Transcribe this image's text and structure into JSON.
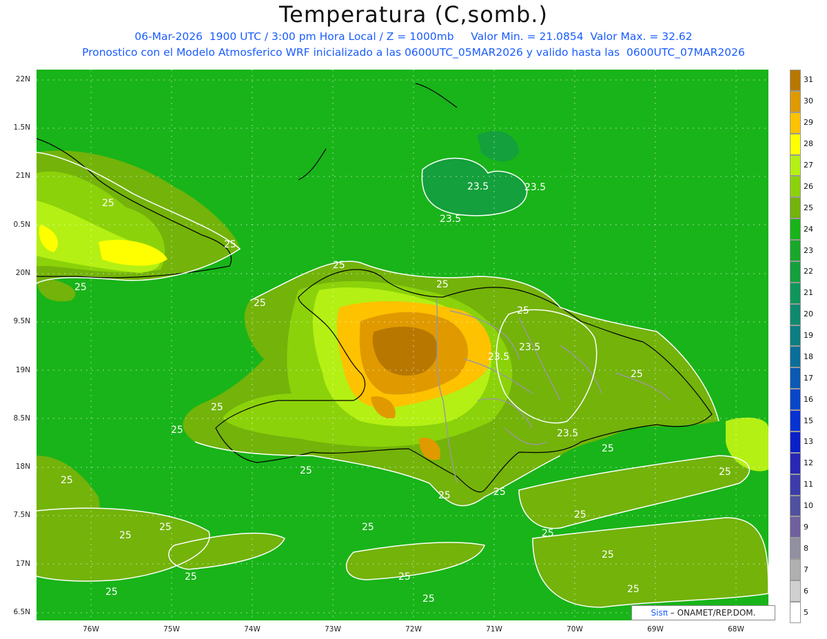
{
  "header": {
    "title": "Temperatura (C,somb.)",
    "line1": "06-Mar-2026  1900 UTC / 3:00 pm Hora Local / Z = 1000mb     Valor Min. = 21.0854  Valor Max. = 32.62",
    "line2": "Pronostico con el Modelo Atmosferico WRF inicializado a las 0600UTC_05MAR2026 y valido hasta las  0600UTC_07MAR2026"
  },
  "y_axis_labels": [
    "22N",
    "1.5N",
    "21N",
    "0.5N",
    "20N",
    "9.5N",
    "19N",
    "8.5N",
    "18N",
    "7.5N",
    "17N",
    "6.5N"
  ],
  "x_axis_labels": [
    "76W",
    "75W",
    "74W",
    "73W",
    "72W",
    "71W",
    "70W",
    "69W",
    "68W"
  ],
  "colorbar": {
    "levels": [
      "31",
      "30",
      "29",
      "28",
      "27",
      "26",
      "25",
      "24",
      "23",
      "22",
      "21",
      "20",
      "19",
      "18",
      "17",
      "16",
      "15",
      "13",
      "12",
      "11",
      "10",
      "9",
      "8",
      "7",
      "6",
      "5"
    ],
    "colors": [
      "#b87800",
      "#e09a00",
      "#ffc200",
      "#ffff00",
      "#b4f014",
      "#8cd20a",
      "#73b30a",
      "#19b419",
      "#19a82a",
      "#14a03c",
      "#10965a",
      "#0f8a6e",
      "#0c7e82",
      "#0a6e9a",
      "#0a5ab4",
      "#0846c8",
      "#0632d2",
      "#0a20c8",
      "#2828b4",
      "#3c3caa",
      "#5050a0",
      "#7060a0",
      "#9090a0",
      "#b0b0b0",
      "#d0d0d0",
      "#ffffff"
    ]
  },
  "contour_labels": [
    "25",
    "23.5"
  ],
  "credit": {
    "sispi": "Sisπ",
    "rest": "– ONAMET/REP.DOM."
  }
}
